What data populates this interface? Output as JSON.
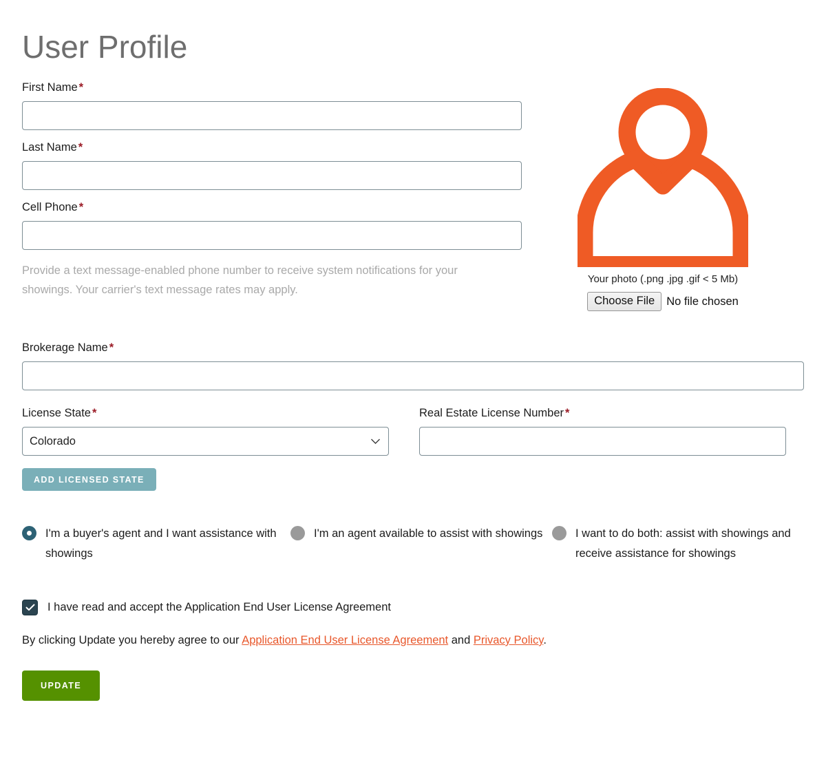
{
  "page": {
    "title": "User Profile"
  },
  "fields": {
    "first_name": {
      "label": "First Name",
      "required_mark": "*",
      "value": "",
      "placeholder": ""
    },
    "last_name": {
      "label": "Last Name",
      "required_mark": "*",
      "value": "",
      "placeholder": ""
    },
    "cell_phone": {
      "label": "Cell Phone",
      "required_mark": "*",
      "value": "",
      "placeholder": ""
    },
    "cell_phone_helper": "Provide a text message-enabled phone number to receive system notifications for your showings. Your carrier's text message rates may apply.",
    "brokerage_name": {
      "label": "Brokerage Name",
      "required_mark": "*",
      "value": "",
      "placeholder": ""
    },
    "license_state": {
      "label": "License State",
      "required_mark": "*",
      "selected": "Colorado",
      "options": [
        "Colorado"
      ]
    },
    "license_number": {
      "label": "Real Estate License Number",
      "required_mark": "*",
      "value": "",
      "placeholder": ""
    }
  },
  "photo": {
    "icon": "user-avatar-icon",
    "caption": "Your photo (.png .jpg .gif < 5 Mb)",
    "choose_file_label": "Choose File",
    "no_file_label": "No file chosen"
  },
  "buttons": {
    "add_licensed_state": "ADD LICENSED STATE",
    "update": "UPDATE"
  },
  "role_options": [
    {
      "label": "I'm a buyer's agent and I want assistance with showings",
      "selected": true
    },
    {
      "label": "I'm an agent available to assist with showings",
      "selected": false
    },
    {
      "label": "I want to do both: assist with showings and receive assistance for showings",
      "selected": false
    }
  ],
  "eula": {
    "checkbox_label": "I have read and accept the Application End User License Agreement",
    "checked": true,
    "agreement_prefix": "By clicking Update you hereby agree to our ",
    "agreement_link1": "Application End User License Agreement",
    "agreement_middle": " and ",
    "agreement_link2": "Privacy Policy",
    "agreement_suffix": "."
  },
  "colors": {
    "title_gray": "#6e6e6e",
    "required_red": "#9b1b26",
    "avatar_orange": "#ef5b25",
    "teal_button": "#7aafb8",
    "update_green": "#559100",
    "link_orange": "#e8572b",
    "radio_selected": "#2d6275",
    "radio_unselected": "#9a9a9a",
    "checkbox_fill": "#2b4450",
    "input_border": "#7c8d94",
    "helper_gray": "#a9a9a9"
  }
}
